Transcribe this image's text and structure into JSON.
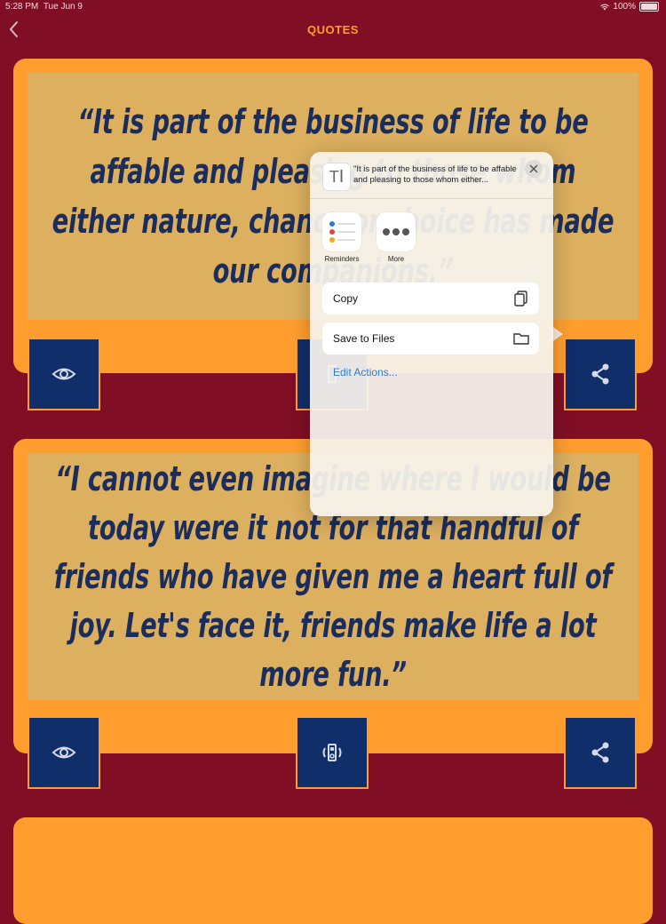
{
  "status_bar": {
    "time": "5:28 PM",
    "date": "Tue Jun 9",
    "battery": "100%"
  },
  "nav": {
    "title": "QUOTES"
  },
  "quotes": [
    "“It is part of the business of life to be affable and pleasing to those whom either nature, chance or choice has made our companions.”",
    "“I cannot even imagine where I would be today were it not for that handful of friends who have given me a heart full of joy. Let's face it, friends make life a lot more fun.”"
  ],
  "share_sheet": {
    "preview_text": "\"It is part of the business of life to be affable and pleasing to those whom either...",
    "apps": [
      {
        "label": "Reminders",
        "icon": "reminders-icon"
      },
      {
        "label": "More",
        "icon": "more-icon"
      }
    ],
    "actions": [
      {
        "label": "Copy",
        "icon": "copy-icon"
      },
      {
        "label": "Save to Files",
        "icon": "folder-icon"
      }
    ],
    "edit_actions": "Edit Actions..."
  },
  "colors": {
    "background": "#800f25",
    "card_frame": "#ff9e2f",
    "card_face": "#ddb060",
    "quote_text": "#1a2d5c",
    "button": "#0f2e6a",
    "link": "#2a7bd8"
  }
}
